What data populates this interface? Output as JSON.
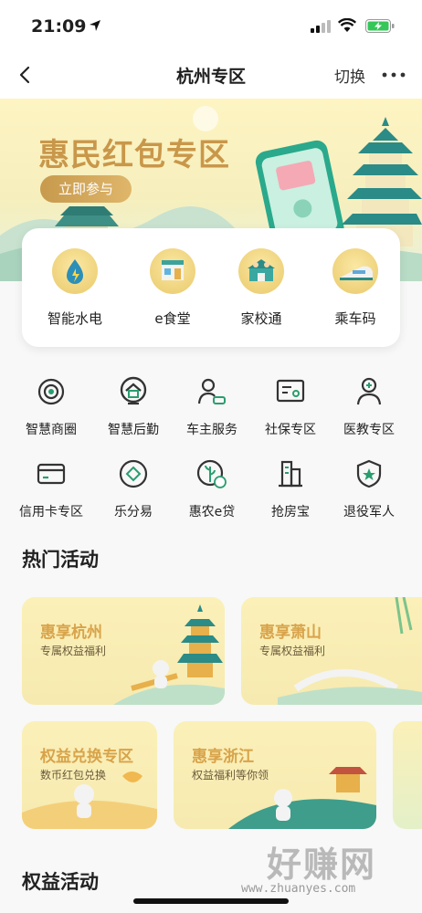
{
  "status": {
    "time": "21:09"
  },
  "nav": {
    "title": "杭州专区",
    "switch_label": "切换"
  },
  "banner": {
    "title": "惠民红包专区",
    "join_label": "立即参与"
  },
  "quick_items": [
    {
      "label": "智能水电",
      "icon": "water-electric-icon"
    },
    {
      "label": "e食堂",
      "icon": "canteen-icon"
    },
    {
      "label": "家校通",
      "icon": "school-icon"
    },
    {
      "label": "乘车码",
      "icon": "train-icon"
    }
  ],
  "services": [
    {
      "label": "智慧商圈",
      "icon": "shop-district-icon"
    },
    {
      "label": "智慧后勤",
      "icon": "logistics-icon"
    },
    {
      "label": "车主服务",
      "icon": "car-owner-icon"
    },
    {
      "label": "社保专区",
      "icon": "social-security-icon"
    },
    {
      "label": "医教专区",
      "icon": "medical-icon"
    },
    {
      "label": "信用卡专区",
      "icon": "credit-card-icon"
    },
    {
      "label": "乐分易",
      "icon": "installment-icon"
    },
    {
      "label": "惠农e贷",
      "icon": "agri-loan-icon"
    },
    {
      "label": "抢房宝",
      "icon": "building-icon"
    },
    {
      "label": "退役军人",
      "icon": "veteran-icon"
    }
  ],
  "hot": {
    "title": "热门活动",
    "cards": [
      {
        "title": "惠享杭州",
        "subtitle": "专属权益福利"
      },
      {
        "title": "惠享萧山",
        "subtitle": "专属权益福利"
      },
      {
        "title": "权益兑换专区",
        "subtitle": "数币红包兑换"
      },
      {
        "title": "惠享浙江",
        "subtitle": "权益福利等你领"
      }
    ]
  },
  "rights": {
    "title": "权益活动"
  },
  "watermark": {
    "text": "好赚网",
    "url": "www.zhuanyes.com"
  },
  "colors": {
    "brand_gold": "#c9974a",
    "accent_green": "#2a9d6f"
  }
}
